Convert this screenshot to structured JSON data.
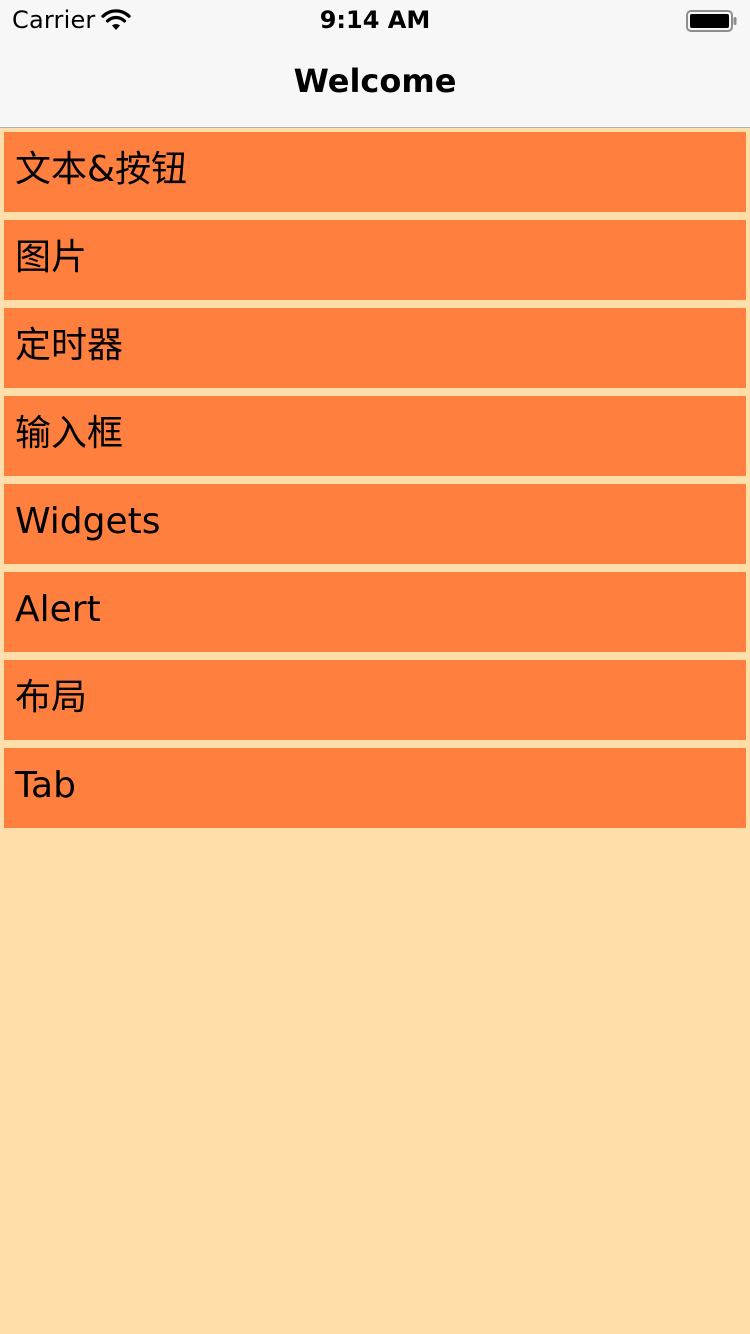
{
  "status_bar": {
    "carrier": "Carrier",
    "time": "9:14 AM",
    "wifi_icon": "wifi-icon",
    "battery_icon": "battery-icon"
  },
  "nav": {
    "title": "Welcome"
  },
  "menu": {
    "items": [
      {
        "label": "文本&按钮"
      },
      {
        "label": "图片"
      },
      {
        "label": "定时器"
      },
      {
        "label": "输入框"
      },
      {
        "label": "Widgets"
      },
      {
        "label": "Alert"
      },
      {
        "label": "布局"
      },
      {
        "label": "Tab"
      }
    ]
  },
  "colors": {
    "nav_background": "#F7F7F7",
    "item_background": "#FF7F3F",
    "page_background": "#FFDEAA"
  }
}
